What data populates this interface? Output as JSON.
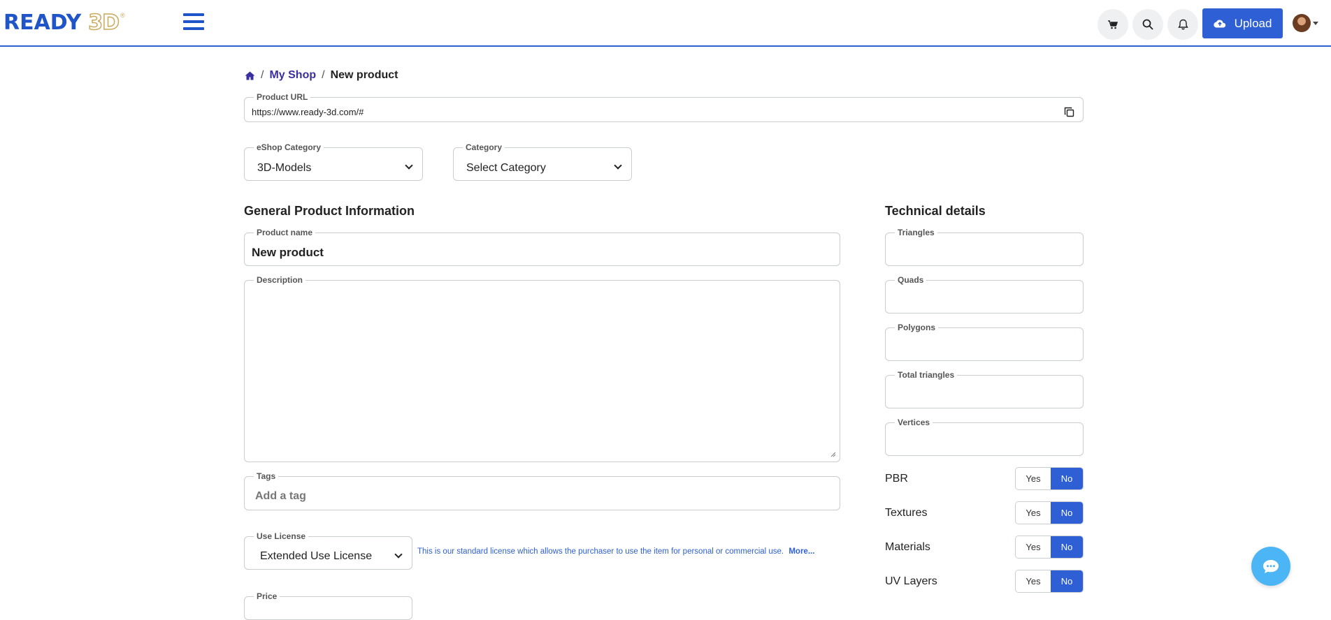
{
  "header": {
    "logo_main": "READY",
    "logo_3d": "3D",
    "logo_reg": "®",
    "upload_label": "Upload"
  },
  "breadcrumb": {
    "home_icon": "home-icon",
    "shop": "My Shop",
    "current": "New product",
    "separator": "/"
  },
  "product_url": {
    "legend": "Product URL",
    "value": "https://www.ready-3d.com/#"
  },
  "eshop_category": {
    "legend": "eShop Category",
    "selected": "3D-Models"
  },
  "category": {
    "legend": "Category",
    "selected": "Select Category"
  },
  "general": {
    "title": "General Product Information",
    "product_name_legend": "Product name",
    "product_name_value": "New product",
    "description_legend": "Description",
    "tags_legend": "Tags",
    "tags_placeholder": "Add a tag",
    "license_legend": "Use License",
    "license_selected": "Extended Use License",
    "license_note": "This is our standard license which allows the purchaser to use the item for personal or commercial use.",
    "license_more": "More...",
    "price_legend": "Price"
  },
  "technical": {
    "title": "Technical details",
    "fields": [
      "Triangles",
      "Quads",
      "Polygons",
      "Total triangles",
      "Vertices"
    ],
    "toggles": [
      {
        "label": "PBR",
        "yes": "Yes",
        "no": "No",
        "selected": "No"
      },
      {
        "label": "Textures",
        "yes": "Yes",
        "no": "No",
        "selected": "No"
      },
      {
        "label": "Materials",
        "yes": "Yes",
        "no": "No",
        "selected": "No"
      },
      {
        "label": "UV Layers",
        "yes": "Yes",
        "no": "No",
        "selected": "No"
      }
    ]
  },
  "colors": {
    "brand_blue": "#2e5fd4",
    "logo_gold": "#c9a95c",
    "chat_blue": "#4cb5f5"
  }
}
